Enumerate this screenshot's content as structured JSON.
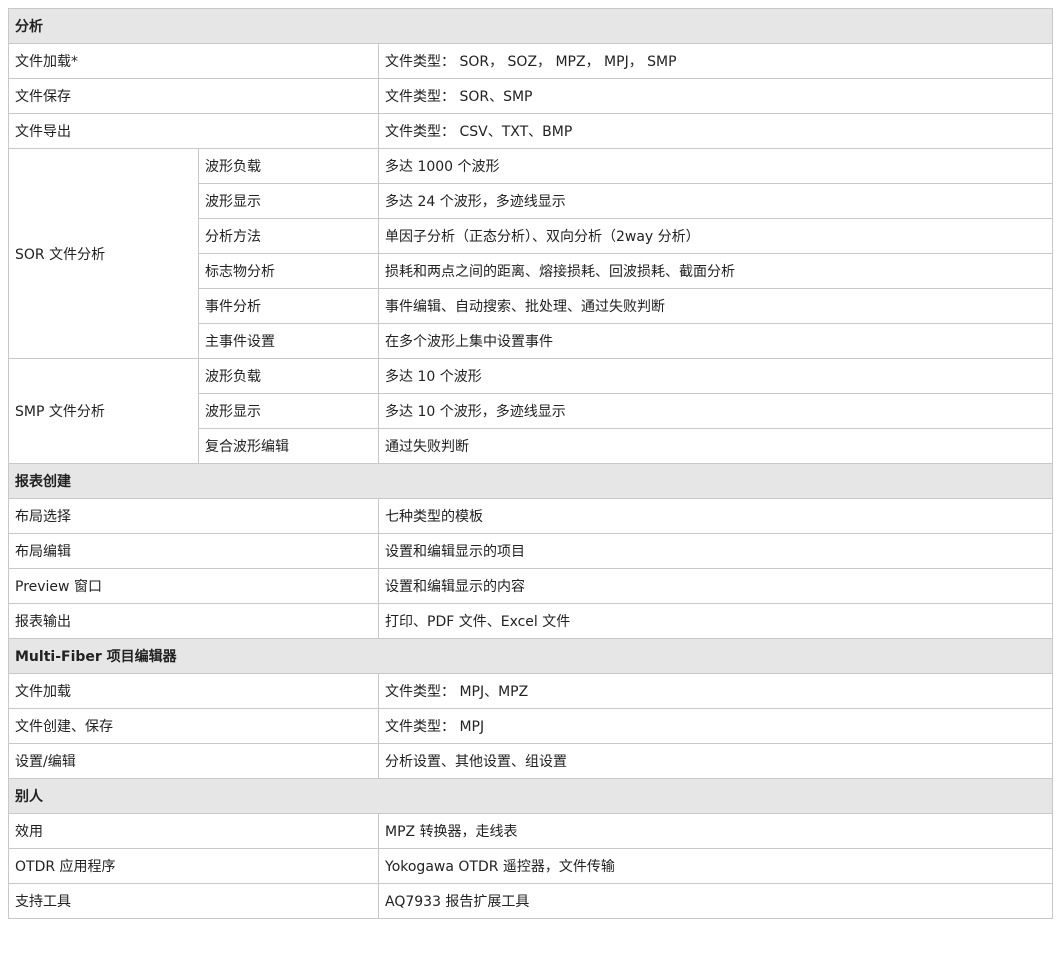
{
  "sections": {
    "analysis": {
      "title": "分析",
      "rows": [
        {
          "label": "文件加载*",
          "value": "文件类型： SOR， SOZ， MPZ， MPJ， SMP"
        },
        {
          "label": "文件保存",
          "value": "文件类型： SOR、SMP"
        },
        {
          "label": "文件导出",
          "value": "文件类型： CSV、TXT、BMP"
        }
      ],
      "sor": {
        "label": "SOR 文件分析",
        "rows": [
          {
            "label": "波形负载",
            "value": "多达 1000 个波形"
          },
          {
            "label": "波形显示",
            "value": "多达 24 个波形，多迹线显示"
          },
          {
            "label": "分析方法",
            "value": "单因子分析（正态分析）、双向分析（2way 分析）"
          },
          {
            "label": "标志物分析",
            "value": "损耗和两点之间的距离、熔接损耗、回波损耗、截面分析"
          },
          {
            "label": "事件分析",
            "value": "事件编辑、自动搜索、批处理、通过失败判断"
          },
          {
            "label": "主事件设置",
            "value": "在多个波形上集中设置事件"
          }
        ]
      },
      "smp": {
        "label": "SMP 文件分析",
        "rows": [
          {
            "label": "波形负载",
            "value": "多达 10 个波形"
          },
          {
            "label": "波形显示",
            "value": "多达 10 个波形，多迹线显示"
          },
          {
            "label": "复合波形编辑",
            "value": "通过失败判断"
          }
        ]
      }
    },
    "report": {
      "title": "报表创建",
      "rows": [
        {
          "label": "布局选择",
          "value": "七种类型的模板"
        },
        {
          "label": "布局编辑",
          "value": "设置和编辑显示的项目"
        },
        {
          "label": "Preview 窗口",
          "value": "设置和编辑显示的内容"
        },
        {
          "label": "报表输出",
          "value": "打印、PDF 文件、Excel 文件"
        }
      ]
    },
    "multifiber": {
      "title": "Multi-Fiber 项目编辑器",
      "rows": [
        {
          "label": "文件加载",
          "value": "文件类型： MPJ、MPZ"
        },
        {
          "label": "文件创建、保存",
          "value": "文件类型： MPJ"
        },
        {
          "label": "设置/编辑",
          "value": "分析设置、其他设置、组设置"
        }
      ]
    },
    "others": {
      "title": "别人",
      "rows": [
        {
          "label": "效用",
          "value": "MPZ 转换器，走线表"
        },
        {
          "label": "OTDR 应用程序",
          "value": "Yokogawa OTDR 遥控器，文件传输"
        },
        {
          "label": "支持工具",
          "value": "AQ7933 报告扩展工具"
        }
      ]
    }
  },
  "colors": {
    "header_bg": "#e6e6e6",
    "border": "#c8c8c8",
    "text": "#222222"
  }
}
